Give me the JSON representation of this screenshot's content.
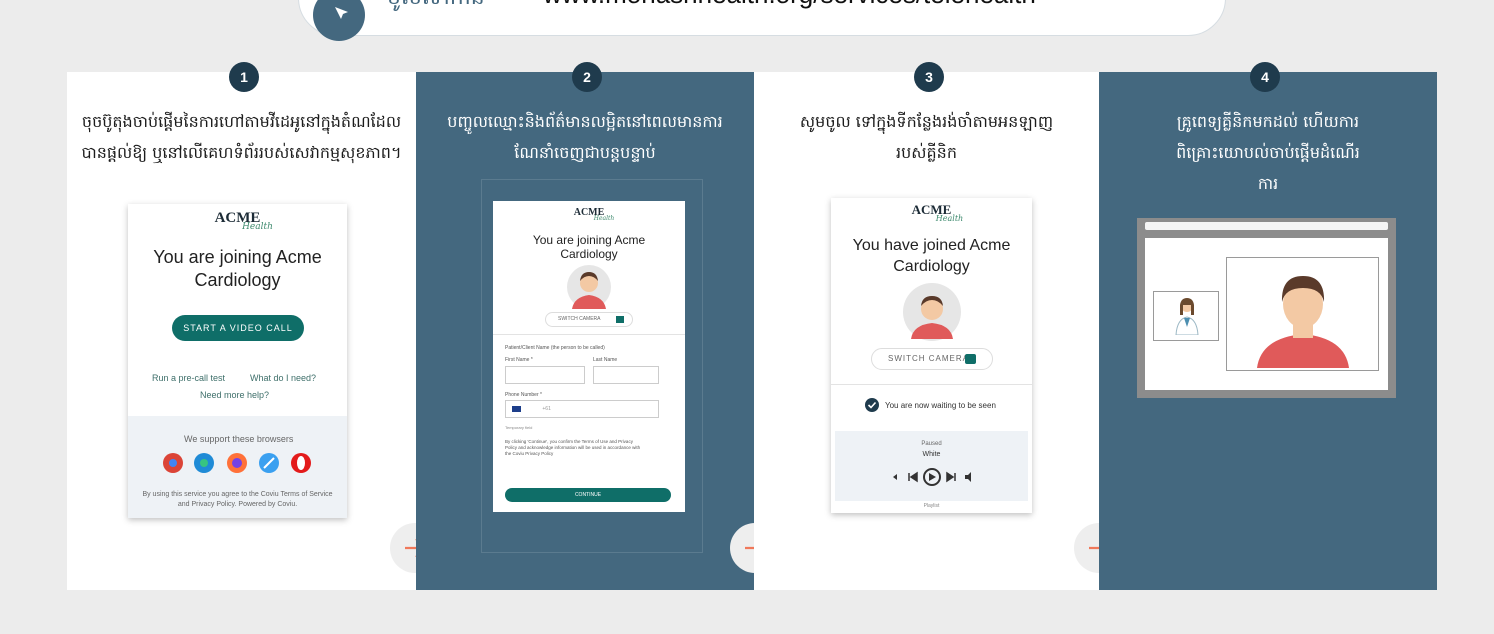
{
  "header": {
    "label": "ចូលទៅកាន់",
    "url": "www.monashhealth.org/services/telehealth"
  },
  "steps": [
    {
      "number": "1",
      "text": "ចុចប៊ូតុងចាប់ផ្តើមនៃការហៅតាមវីដេអូនៅក្នុងតំណដែលបានផ្តល់ឱ្យ ឬនៅលើគេហទំព័ររបស់សេវាកម្មសុខភាព។",
      "mockup": {
        "logo": "ACME",
        "logo_sub": "Health",
        "title": "You are joining Acme Cardiology",
        "button": "START A VIDEO CALL",
        "link_precall": "Run a pre-call test",
        "link_need": "What do I need?",
        "link_help": "Need more help?",
        "browsers_caption": "We support these browsers",
        "footer": "By using this service you agree to the Coviu Terms of Service and Privacy Policy. Powered by Coviu."
      }
    },
    {
      "number": "2",
      "text": "បញ្ចូលឈ្មោះនិងព័ត៌មានលម្អិតនៅពេលមានការណែនាំចេញជាបន្តបន្ទាប់",
      "mockup": {
        "logo": "ACME",
        "logo_sub": "Health",
        "title": "You are joining Acme Cardiology",
        "switch_camera": "SWITCH CAMERA",
        "patient_heading": "Patient/Client Name (the person to be called)",
        "first_name": "First Name *",
        "last_name": "Last Name",
        "phone": "Phone Number *",
        "phone_prefix": "+61",
        "temp_hint": "Temporary field",
        "terms": "By clicking 'Continue', you confirm the Terms of Use and Privacy Policy and acknowledge information will be used in accordance with the Coviu Privacy Policy",
        "continue_btn": "CONTINUE"
      }
    },
    {
      "number": "3",
      "text": "សូមចូល ទៅក្នុងទីកន្លែងរង់ចាំតាមអនឡាញរបស់គ្លីនិក",
      "mockup": {
        "logo": "ACME",
        "logo_sub": "Health",
        "title": "You have joined Acme Cardiology",
        "switch_camera": "SWITCH CAMERA",
        "status": "You are now waiting to be seen",
        "player_state": "Paused",
        "player_track": "White",
        "playlist": "Playlist"
      }
    },
    {
      "number": "4",
      "text": "គ្រូពេទ្យគ្លីនិកមកដល់ ហើយការពិគ្រោះយោបល់ចាប់ផ្តើមដំណើរការ"
    }
  ],
  "colors": {
    "dark_panel": "#44687f",
    "light_panel": "#ffffff",
    "arrow": "#f0785a",
    "teal": "#0f6e68"
  },
  "icons": {
    "arrow": "arrow-right-icon",
    "check": "check-circle-icon",
    "camera": "camera-icon"
  }
}
